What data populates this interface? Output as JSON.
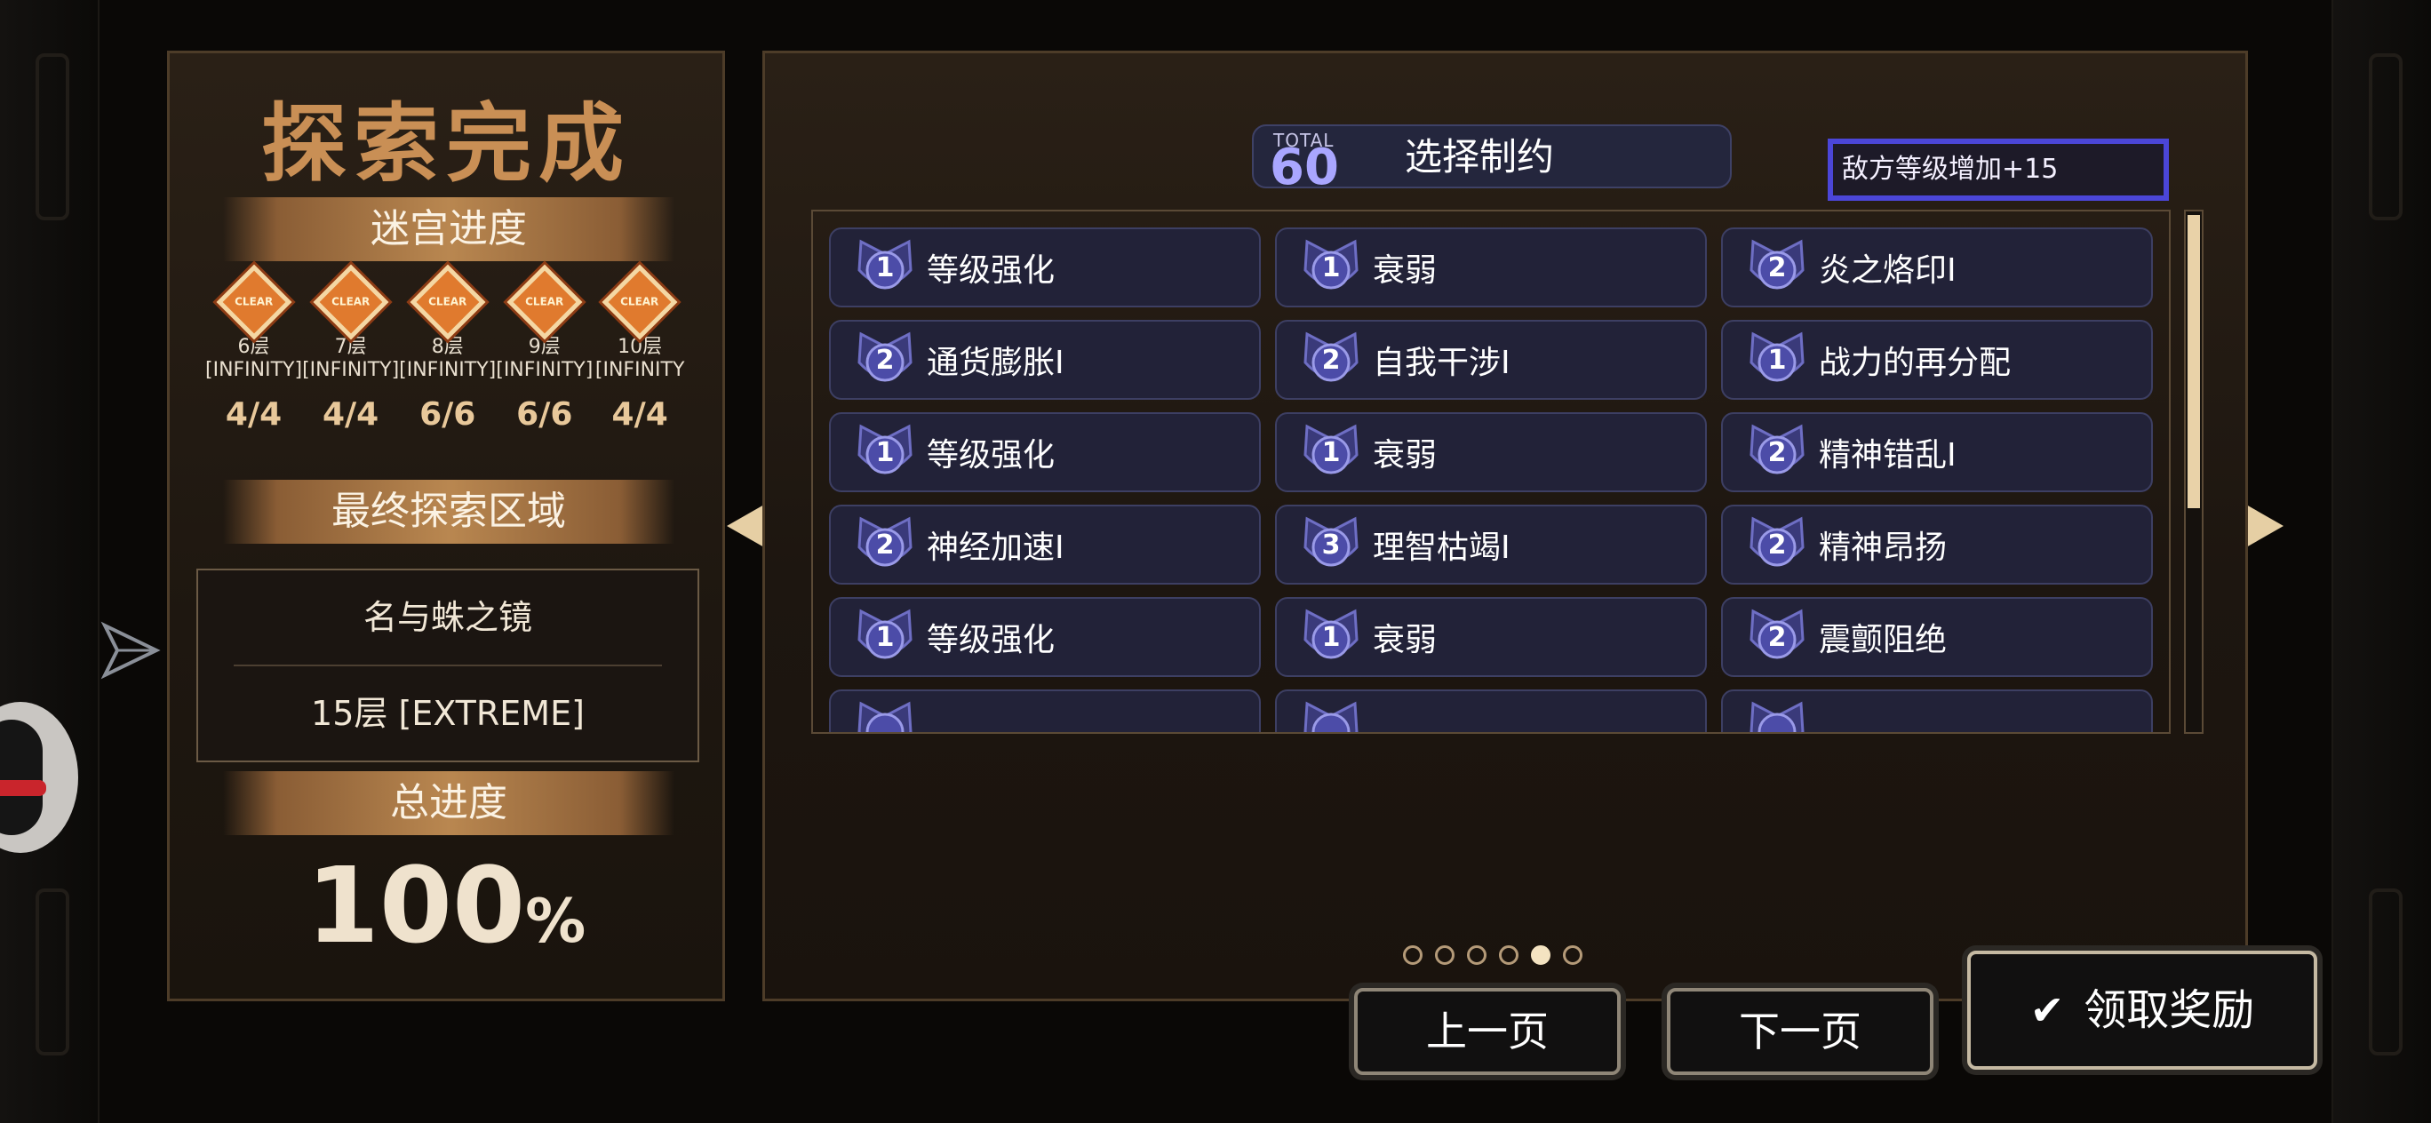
{
  "left": {
    "title": "探索完成",
    "maze_progress_label": "迷宫进度",
    "floors": [
      {
        "floor": "6层",
        "mode": "[INFINITY]",
        "count": "4/4"
      },
      {
        "floor": "7层",
        "mode": "[INFINITY]",
        "count": "4/4"
      },
      {
        "floor": "8层",
        "mode": "[INFINITY]",
        "count": "6/6"
      },
      {
        "floor": "9层",
        "mode": "[INFINITY]",
        "count": "6/6"
      },
      {
        "floor": "10层",
        "mode": "[INFINITY",
        "count": "4/4"
      }
    ],
    "medal_text": "CLEAR",
    "final_area_label": "最终探索区域",
    "final_area_name": "名与蛛之镜",
    "final_area_floor": "15层 [EXTREME]",
    "total_progress_label": "总进度",
    "total_progress_value": "100",
    "total_progress_unit": "%"
  },
  "main": {
    "total_label": "TOTAL",
    "total_value": "60",
    "title": "选择制约",
    "hint": "敌方等级增加+15",
    "cards": [
      {
        "level": "1",
        "name": "等级强化"
      },
      {
        "level": "1",
        "name": "衰弱"
      },
      {
        "level": "2",
        "name": "炎之烙印I"
      },
      {
        "level": "2",
        "name": "通货膨胀I"
      },
      {
        "level": "2",
        "name": "自我干涉I"
      },
      {
        "level": "1",
        "name": "战力的再分配"
      },
      {
        "level": "1",
        "name": "等级强化"
      },
      {
        "level": "1",
        "name": "衰弱"
      },
      {
        "level": "2",
        "name": "精神错乱I"
      },
      {
        "level": "2",
        "name": "神经加速I"
      },
      {
        "level": "3",
        "name": "理智枯竭I"
      },
      {
        "level": "2",
        "name": "精神昂扬"
      },
      {
        "level": "1",
        "name": "等级强化"
      },
      {
        "level": "1",
        "name": "衰弱"
      },
      {
        "level": "2",
        "name": "震颤阻绝"
      },
      {
        "level": "",
        "name": ""
      },
      {
        "level": "",
        "name": ""
      },
      {
        "level": "",
        "name": ""
      }
    ],
    "page_dots": 6,
    "active_page": 5
  },
  "buttons": {
    "prev": "上一页",
    "next": "下一页",
    "claim": "领取奖励",
    "claim_icon": "✔"
  },
  "colors": {
    "accent_gold": "#c98f55",
    "card_bg": "#222238",
    "hint_border": "#4b46d8"
  }
}
